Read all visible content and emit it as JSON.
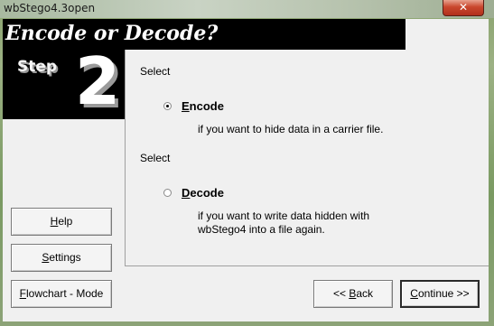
{
  "window": {
    "title": "wbStego4.3open",
    "close_glyph": "✕"
  },
  "header": {
    "title": "Encode or Decode?"
  },
  "step": {
    "word": "Step",
    "number": "2"
  },
  "main": {
    "select_label_1": "Select",
    "select_label_2": "Select",
    "options": [
      {
        "label": "Encode",
        "underline": "E",
        "rest": "ncode",
        "description": "if you want to hide data in a carrier file.",
        "selected": true
      },
      {
        "label": "Decode",
        "underline": "D",
        "rest": "ecode",
        "description_line1": "if you want to write data hidden with",
        "description_line2": "wbStego4 into a file again.",
        "selected": false
      }
    ]
  },
  "sidebar": {
    "help": {
      "underline": "H",
      "rest": "elp"
    },
    "settings": {
      "underline": "S",
      "rest": "ettings"
    },
    "flowchart": {
      "underline": "F",
      "rest": "lowchart - Mode"
    }
  },
  "footer": {
    "back": {
      "prefix": "<< ",
      "underline": "B",
      "rest": "ack"
    },
    "continue": {
      "underline": "C",
      "rest": "ontinue >>"
    }
  }
}
